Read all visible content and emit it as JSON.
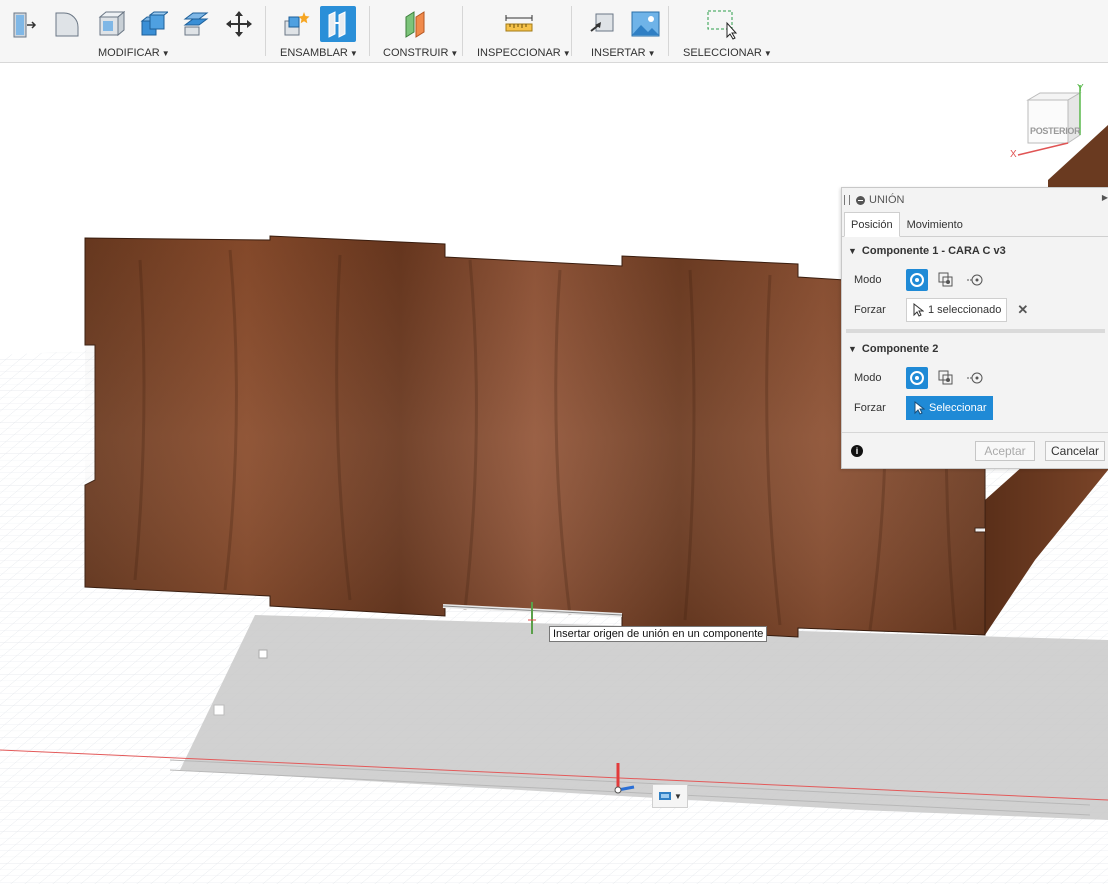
{
  "toolbar": {
    "groups": [
      {
        "label": "MODIFICAR"
      },
      {
        "label": "ENSAMBLAR"
      },
      {
        "label": "CONSTRUIR"
      },
      {
        "label": "INSPECCIONAR"
      },
      {
        "label": "INSERTAR"
      },
      {
        "label": "SELECCIONAR"
      }
    ]
  },
  "viewcube": {
    "face": "POSTERIOR",
    "axis_x": "X",
    "axis_y": "Y"
  },
  "dialog": {
    "title": "UNIÓN",
    "tabs": [
      "Posición",
      "Movimiento"
    ],
    "component1": {
      "title": "Componente 1 - CARA C v3",
      "mode_label": "Modo",
      "snap_label": "Forzar",
      "snap_value": "1 seleccionado"
    },
    "component2": {
      "title": "Componente 2",
      "mode_label": "Modo",
      "snap_label": "Forzar",
      "snap_button": "Seleccionar"
    },
    "ok_label": "Aceptar",
    "cancel_label": "Cancelar"
  },
  "tooltip": "Insertar origen de unión en un componente",
  "colors": {
    "accent": "#1f8ad6",
    "wood_dark": "#5e3219",
    "wood_light": "#9a5a34",
    "grid": "#d9dde2"
  }
}
